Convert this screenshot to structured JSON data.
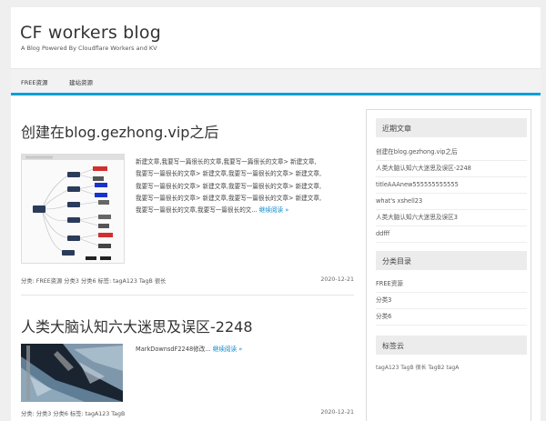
{
  "site": {
    "title": "CF workers blog",
    "description": "A Blog Powered By Cloudflare Workers and KV"
  },
  "nav": {
    "items": [
      {
        "label": "FREE资源"
      },
      {
        "label": "建站资源"
      }
    ]
  },
  "posts": [
    {
      "title": "创建在blog.gezhong.vip之后",
      "excerpt_lines": [
        "新建文章,我要写一篇很长的文章,我要写一篇很长的文章> 新建文章,",
        "我要写一篇很长的文章> 新建文章,我要写一篇很长的文章> 新建文章,",
        "我要写一篇很长的文章> 新建文章,我要写一篇很长的文章> 新建文章,",
        "我要写一篇很长的文章> 新建文章,我要写一篇很长的文章> 新建文章,"
      ],
      "excerpt_last": "我要写一篇很长的文章,我要写一篇很长的文...",
      "read_more": "继续阅读 »",
      "meta_left": "分类: FREE资源 分类3 分类6 标签:   tagA123 TagB 很长",
      "date": "2020-12-21"
    },
    {
      "title": "人类大脑认知六大迷思及误区-2248",
      "excerpt": "MarkDownsdF2248修改...",
      "read_more": "继续阅读 »",
      "meta_left": "分类: 分类3 分类6 标签:   tagA123 TagB",
      "date": "2020-12-21"
    }
  ],
  "sidebar": {
    "recent": {
      "title": "近期文章",
      "items": [
        "创建在blog.gezhong.vip之后",
        "人类大脑认知六大迷思及误区-2248",
        "titleAAAnew555555555555",
        "what's xshell23",
        "人类大脑认知六大迷思及误区3",
        "ddfff"
      ]
    },
    "categories": {
      "title": "分类目录",
      "items": [
        "FREE资源",
        "分类3",
        "分类6"
      ]
    },
    "tags": {
      "title": "标签云",
      "text": "tagA123 TagB 很长 TagB2 tagA"
    }
  },
  "colors": {
    "accent": "#0aa0d8",
    "link": "#0a86c7"
  }
}
